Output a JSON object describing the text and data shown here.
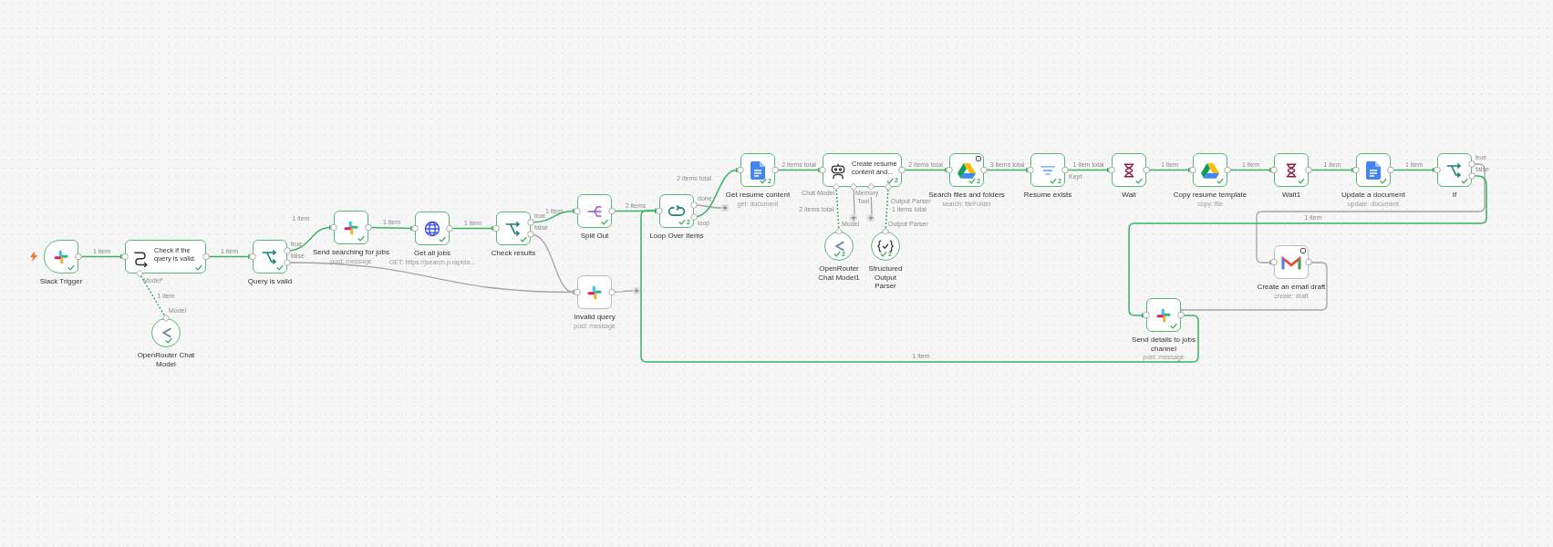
{
  "canvas": {
    "nodes": [
      {
        "kind": "trigger",
        "name": "Slack Trigger",
        "success": true
      },
      {
        "kind": "wide",
        "name": "Check if the query is valid.",
        "success": true,
        "sub_ports": [
          "Model*"
        ]
      },
      {
        "kind": "sub",
        "name": "OpenRouter Chat Model",
        "success": true,
        "input_label": "Model"
      },
      {
        "kind": "node",
        "name": "Query is valid",
        "success": true,
        "outputs": [
          "true",
          "false"
        ]
      },
      {
        "kind": "node",
        "name": "Send searching for jobs",
        "subtitle": "post: message",
        "success": true
      },
      {
        "kind": "node",
        "name": "Get all jobs",
        "subtitle": "GET: https://jsearch.p.rapida...",
        "success": true
      },
      {
        "kind": "node",
        "name": "Check results",
        "success": true,
        "outputs": [
          "true",
          "false"
        ]
      },
      {
        "kind": "node",
        "name": "Split Out",
        "success": true
      },
      {
        "kind": "node",
        "name": "Loop Over Items",
        "success": true,
        "runs": "2",
        "outputs": [
          "done",
          "loop"
        ]
      },
      {
        "kind": "node",
        "name": "Invalid query",
        "subtitle": "post: message",
        "success": false
      },
      {
        "kind": "node",
        "name": "Get resume content",
        "subtitle": "get: document",
        "success": true,
        "runs": "2"
      },
      {
        "kind": "wide",
        "name": "Create resume content and...",
        "success": true,
        "runs": "2",
        "sub_ports": [
          "Chat Model",
          "Memory",
          "Tool",
          "Output Parser"
        ]
      },
      {
        "kind": "sub",
        "name": "OpenRouter Chat Model1",
        "success": true,
        "runs": "2",
        "input_label": "Model"
      },
      {
        "kind": "sub",
        "name": "Structured Output Parser",
        "success": true,
        "runs": "2",
        "input_label": "Output Parser"
      },
      {
        "kind": "node",
        "name": "Search files and folders",
        "subtitle": "search: fileFolder",
        "success": true,
        "runs": "2",
        "pinned": true
      },
      {
        "kind": "node",
        "name": "Resume exists",
        "success": true,
        "runs": "2",
        "outputs": [
          "Kept"
        ]
      },
      {
        "kind": "node",
        "name": "Wait",
        "success": true
      },
      {
        "kind": "node",
        "name": "Copy resume template",
        "subtitle": "copy: file",
        "success": true
      },
      {
        "kind": "node",
        "name": "Wait1",
        "success": true
      },
      {
        "kind": "node",
        "name": "Update a document",
        "subtitle": "update: document",
        "success": true
      },
      {
        "kind": "node",
        "name": "If",
        "success": true,
        "outputs": [
          "true",
          "false"
        ]
      },
      {
        "kind": "node",
        "name": "Create an email draft",
        "subtitle": "create: draft",
        "success": false,
        "pinned": true
      },
      {
        "kind": "node",
        "name": "Send details to jobs channel",
        "subtitle": "post: message",
        "success": true
      }
    ],
    "connections": [
      {
        "label": "1 item",
        "executed": true
      },
      {
        "label": "1 item",
        "executed": true
      },
      {
        "label": "1 item",
        "executed": true
      },
      {
        "label": "1 item",
        "executed": true
      },
      {
        "executed": false
      },
      {
        "label": "1 item",
        "executed": true
      },
      {
        "label": "1 item",
        "executed": true
      },
      {
        "label": "1 item",
        "executed": true
      },
      {
        "executed": false
      },
      {
        "label": "2 items",
        "executed": true
      },
      {
        "executed": false
      },
      {
        "label": "2 items total",
        "executed": true
      },
      {
        "label": "2 items total",
        "executed": true
      },
      {
        "label": "2 items total",
        "executed": true
      },
      {
        "label": "1 items total",
        "executed": true
      },
      {
        "label": "2 items total",
        "executed": true
      },
      {
        "label": "3 items total",
        "executed": true
      },
      {
        "label": "1 item total",
        "executed": true
      },
      {
        "label": "1 item",
        "executed": true
      },
      {
        "label": "1 item",
        "executed": true
      },
      {
        "label": "1 item",
        "executed": true
      },
      {
        "label": "1 item",
        "executed": true
      },
      {
        "executed": false
      },
      {
        "label": "1 item",
        "executed": true
      },
      {
        "executed": false
      },
      {
        "label": "1 item",
        "executed": true
      },
      {
        "executed": false
      },
      {
        "executed": false
      },
      {
        "executed": false
      }
    ]
  }
}
